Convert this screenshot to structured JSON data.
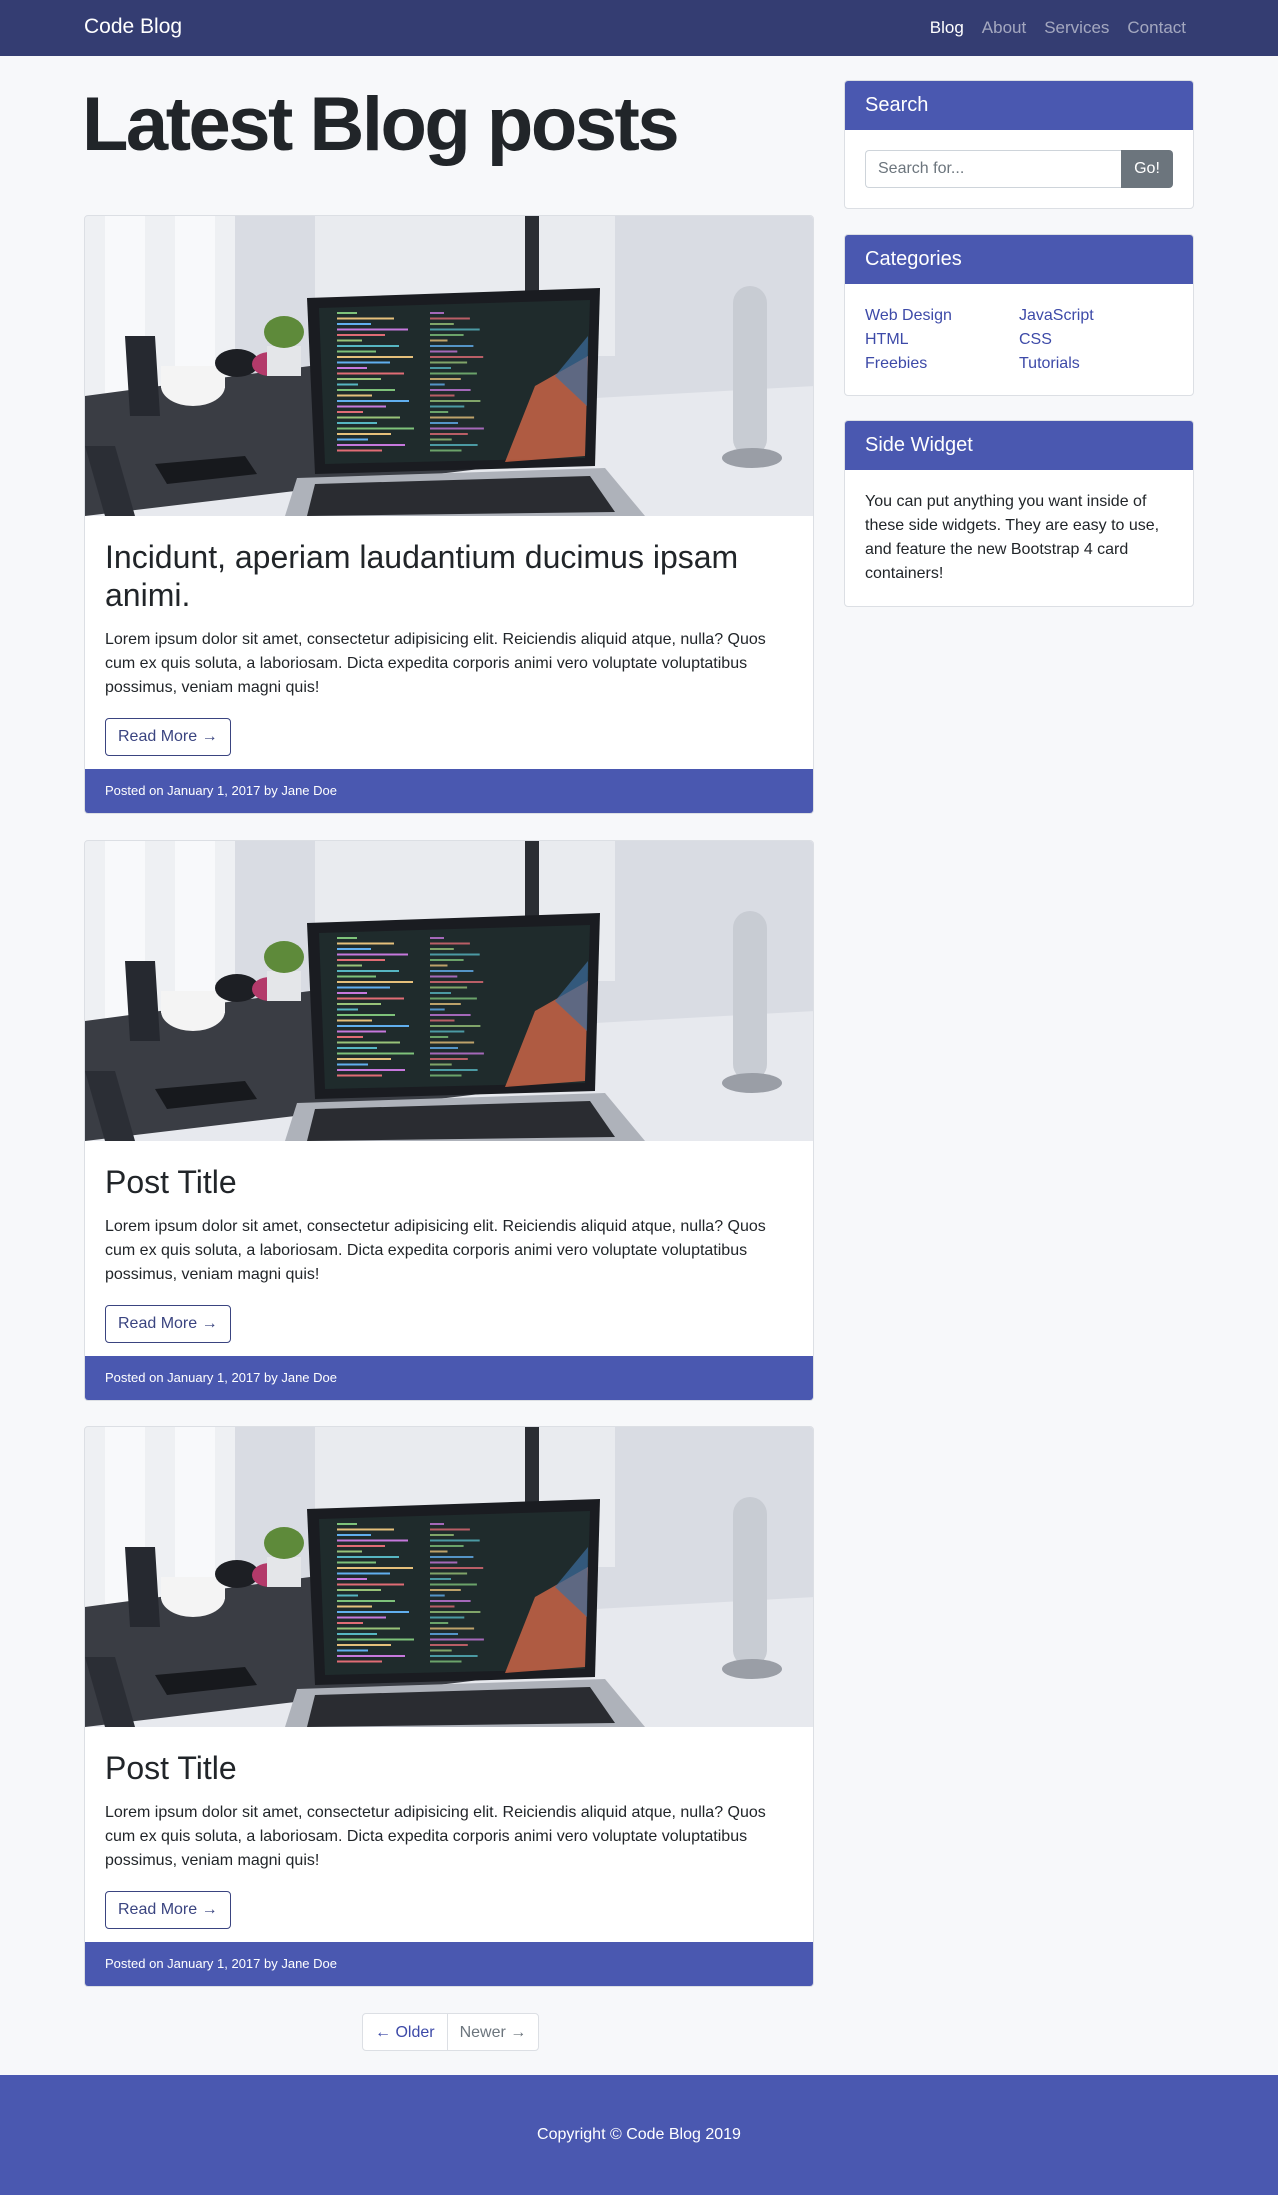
{
  "navbar": {
    "brand": "Code Blog",
    "links": [
      {
        "label": "Blog",
        "active": true
      },
      {
        "label": "About",
        "active": false
      },
      {
        "label": "Services",
        "active": false
      },
      {
        "label": "Contact",
        "active": false
      }
    ]
  },
  "page_title": "Latest Blog posts",
  "posts": [
    {
      "title": "Incidunt, aperiam laudantium ducimus ipsam animi.",
      "excerpt": "Lorem ipsum dolor sit amet, consectetur adipisicing elit. Reiciendis aliquid atque, nulla? Quos cum ex quis soluta, a laboriosam. Dicta expedita corporis animi vero voluptate voluptatibus possimus, veniam magni quis!",
      "read_more": "Read More →",
      "meta": "Posted on January 1, 2017 by Jane Doe"
    },
    {
      "title": "Post Title",
      "excerpt": "Lorem ipsum dolor sit amet, consectetur adipisicing elit. Reiciendis aliquid atque, nulla? Quos cum ex quis soluta, a laboriosam. Dicta expedita corporis animi vero voluptate voluptatibus possimus, veniam magni quis!",
      "read_more": "Read More →",
      "meta": "Posted on January 1, 2017 by Jane Doe"
    },
    {
      "title": "Post Title",
      "excerpt": "Lorem ipsum dolor sit amet, consectetur adipisicing elit. Reiciendis aliquid atque, nulla? Quos cum ex quis soluta, a laboriosam. Dicta expedita corporis animi vero voluptate voluptatibus possimus, veniam magni quis!",
      "read_more": "Read More →",
      "meta": "Posted on January 1, 2017 by Jane Doe"
    }
  ],
  "sidebar": {
    "search": {
      "title": "Search",
      "placeholder": "Search for...",
      "button": "Go!"
    },
    "categories": {
      "title": "Categories",
      "left": [
        "Web Design",
        "HTML",
        "Freebies"
      ],
      "right": [
        "JavaScript",
        "CSS",
        "Tutorials"
      ]
    },
    "widget": {
      "title": "Side Widget",
      "text": "You can put anything you want inside of these side widgets. They are easy to use, and feature the new Bootstrap 4 card containers!"
    }
  },
  "pager": {
    "older": "← Older",
    "newer": "Newer →"
  },
  "footer": {
    "copyright": "Copyright © Code Blog 2019"
  },
  "colors": {
    "navbar": "#343d72",
    "accent": "#4a58b0",
    "link": "#3d4aa8",
    "page_bg": "#f7f8fa"
  }
}
